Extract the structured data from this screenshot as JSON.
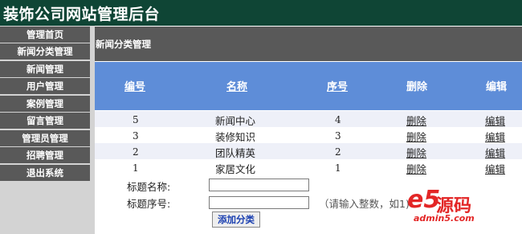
{
  "header": {
    "title": "装饰公司网站管理后台"
  },
  "sidebar": {
    "items": [
      {
        "label": "管理首页"
      },
      {
        "label": "新闻分类管理"
      },
      {
        "label": "新闻管理"
      },
      {
        "label": "用户管理"
      },
      {
        "label": "案例管理"
      },
      {
        "label": "留言管理"
      },
      {
        "label": "管理员管理"
      },
      {
        "label": "招聘管理"
      },
      {
        "label": "退出系统"
      }
    ]
  },
  "main": {
    "page_title": "新闻分类管理",
    "table": {
      "headers": {
        "id": "编号",
        "name": "名称",
        "order": "序号",
        "delete": "删除",
        "edit": "编辑"
      },
      "rows": [
        {
          "id": "5",
          "name": "新闻中心",
          "order": "4",
          "delete": "删除",
          "edit": "编辑"
        },
        {
          "id": "3",
          "name": "装修知识",
          "order": "3",
          "delete": "删除",
          "edit": "编辑"
        },
        {
          "id": "2",
          "name": "团队精英",
          "order": "2",
          "delete": "删除",
          "edit": "编辑"
        },
        {
          "id": "1",
          "name": "家居文化",
          "order": "1",
          "delete": "删除",
          "edit": "编辑"
        }
      ]
    },
    "form": {
      "title_label": "标题名称:",
      "order_label": "标题序号:",
      "title_value": "",
      "order_value": "",
      "hint": "（请输入整数，如1)",
      "submit_label": "添加分类"
    }
  },
  "watermark": {
    "logo": "e5",
    "text": "源码",
    "url": "admin5.com"
  },
  "colors": {
    "header_bg": "#0f4535",
    "menu_bg": "#595959",
    "sidebar_bg": "#d3d3d3",
    "table_header_bg": "#5e8dd8",
    "row_alt_bg": "#eef0f8",
    "watermark": "#e32626"
  }
}
